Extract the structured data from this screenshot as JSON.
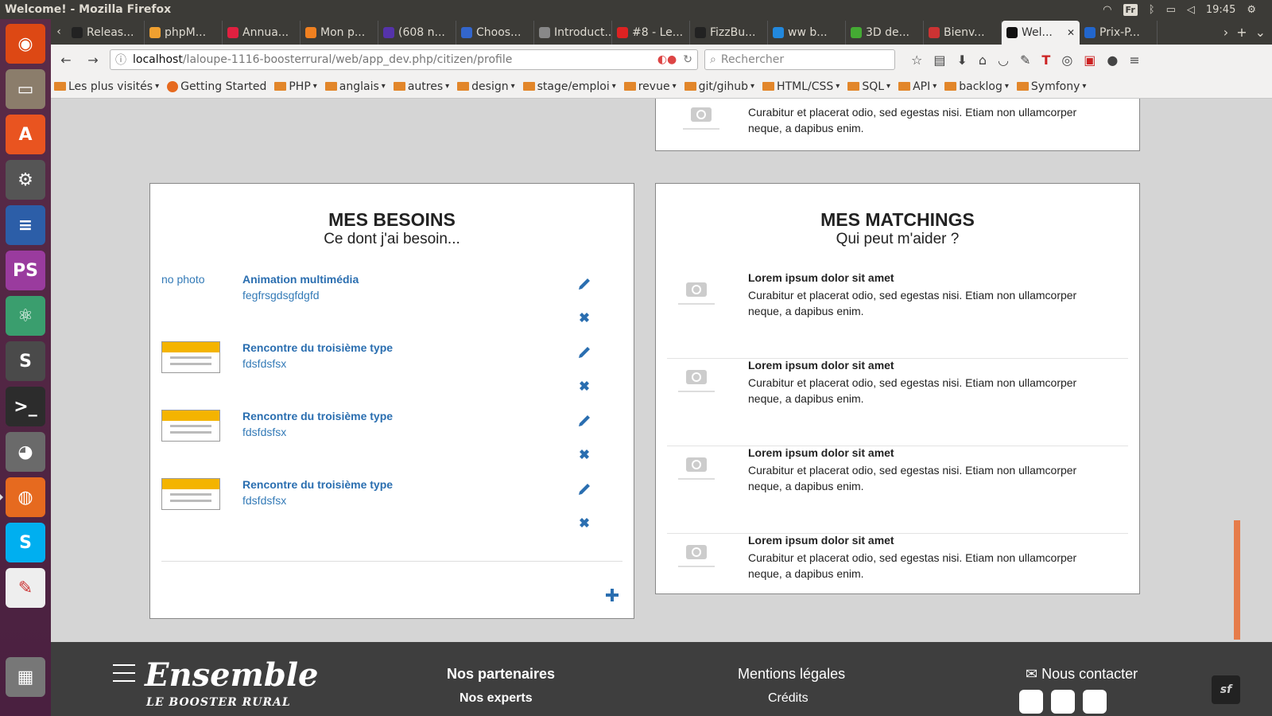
{
  "system": {
    "window_title": "Welcome! - Mozilla Firefox",
    "keyboard": "Fr",
    "clock": "19:45"
  },
  "launcher": {
    "items": [
      "ubuntu-icon",
      "files-icon",
      "software-center-icon",
      "settings-icon",
      "writer-icon",
      "phpstorm-icon",
      "atom-icon",
      "sublime-icon",
      "terminal-icon",
      "gimp-icon",
      "firefox-icon",
      "skype-icon",
      "viewer-icon",
      "trash-icon"
    ]
  },
  "tabs": [
    {
      "label": "Releas...",
      "color": "#222222"
    },
    {
      "label": "phpM...",
      "color": "#f0a030"
    },
    {
      "label": "Annua...",
      "color": "#e02040"
    },
    {
      "label": "Mon p...",
      "color": "#f08020"
    },
    {
      "label": "(608 n...",
      "color": "#5533aa"
    },
    {
      "label": "Choos...",
      "color": "#3366cc"
    },
    {
      "label": "Introduct...",
      "color": "#888888"
    },
    {
      "label": "#8 - Le...",
      "color": "#dd2222"
    },
    {
      "label": "FizzBu...",
      "color": "#222222"
    },
    {
      "label": "ww b...",
      "color": "#2288dd"
    },
    {
      "label": "3D de...",
      "color": "#44aa33"
    },
    {
      "label": "Bienv...",
      "color": "#cc3333"
    },
    {
      "label": "Wel...",
      "color": "#111111",
      "active": true
    },
    {
      "label": "Prix-P...",
      "color": "#2266cc"
    }
  ],
  "navbar": {
    "url_host": "localhost",
    "url_path": "/laloupe-1116-boosterrural/web/app_dev.php/citizen/profile",
    "search_placeholder": "Rechercher"
  },
  "bookmarks": [
    "Les plus visités",
    "Getting Started",
    "PHP",
    "anglais",
    "autres",
    "design",
    "stage/emploi",
    "revue",
    "git/gihub",
    "HTML/CSS",
    "SQL",
    "API",
    "backlog",
    "Symfony"
  ],
  "top_partial_match": {
    "text": "Curabitur et placerat odio, sed egestas nisi. Etiam non ullamcorper neque, a dapibus enim."
  },
  "besoins": {
    "title": "MES BESOINS",
    "subtitle": "Ce dont j'ai besoin...",
    "items": [
      {
        "photo": "no photo",
        "title": "Animation multimédia",
        "desc": "fegfrsgdsgfdgfd"
      },
      {
        "photo": "thumbnail",
        "title": "Rencontre du troisième type",
        "desc": "fdsfdsfsx"
      },
      {
        "photo": "thumbnail",
        "title": "Rencontre du troisième type",
        "desc": "fdsfdsfsx"
      },
      {
        "photo": "thumbnail",
        "title": "Rencontre du troisième type",
        "desc": "fdsfdsfsx"
      }
    ]
  },
  "matchings": {
    "title": "MES MATCHINGS",
    "subtitle": "Qui peut m'aider ?",
    "items": [
      {
        "title": "Lorem ipsum dolor sit amet",
        "text": "Curabitur et placerat odio, sed egestas nisi. Etiam non ullamcorper neque, a dapibus enim."
      },
      {
        "title": "Lorem ipsum dolor sit amet",
        "text": "Curabitur et placerat odio, sed egestas nisi. Etiam non ullamcorper neque, a dapibus enim."
      },
      {
        "title": "Lorem ipsum dolor sit amet",
        "text": "Curabitur et placerat odio, sed egestas nisi. Etiam non ullamcorper neque, a dapibus enim."
      },
      {
        "title": "Lorem ipsum dolor sit amet",
        "text": "Curabitur et placerat odio, sed egestas nisi. Etiam non ullamcorper neque, a dapibus enim."
      }
    ]
  },
  "footer": {
    "brand": "Ensemble",
    "tagline": "LE BOOSTER RURAL",
    "partners": "Nos partenaires",
    "experts": "Nos experts",
    "legal": "Mentions légales",
    "credits": "Crédits",
    "contact": "Nous contacter"
  },
  "colors": {
    "link": "#337ab7",
    "accent_yellow": "#f4b400",
    "footer_bg": "#3e3e3e",
    "launcher_bg": "#5a2c48"
  }
}
